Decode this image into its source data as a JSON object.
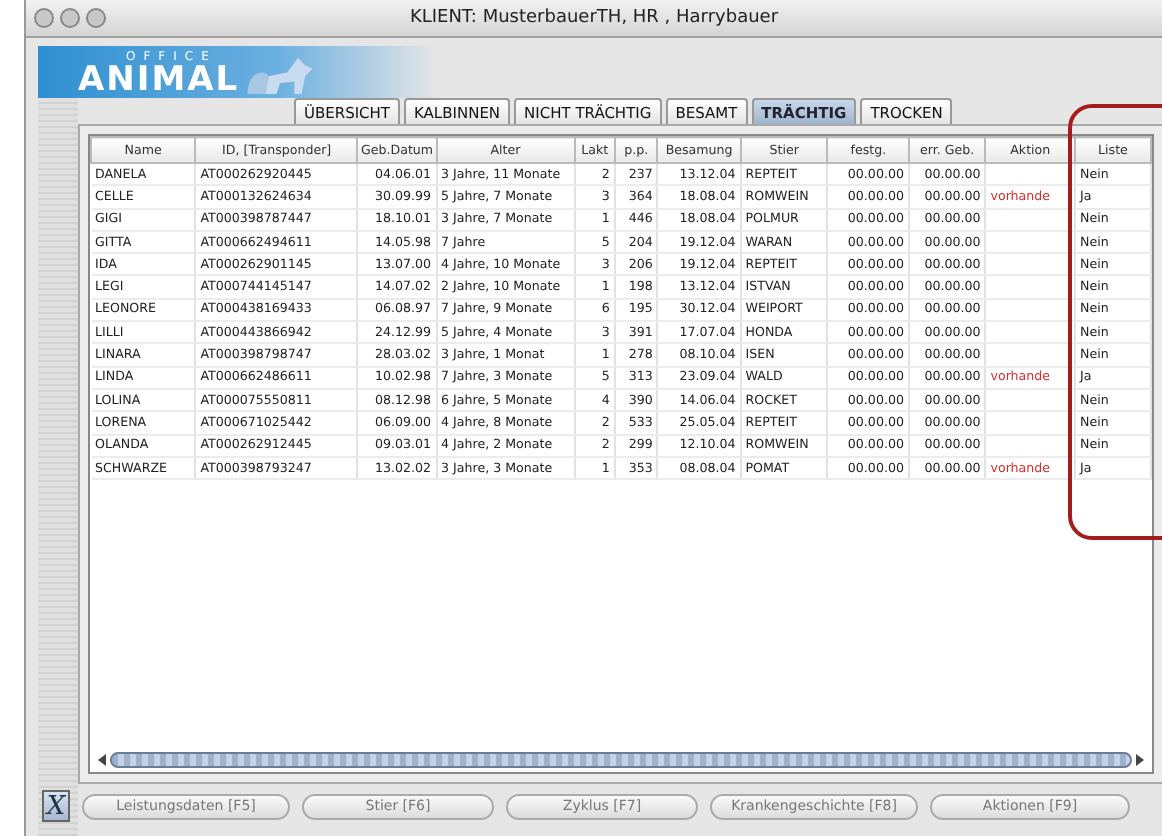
{
  "window": {
    "title": "KLIENT: MusterbauerTH, HR , Harrybauer"
  },
  "logo": {
    "overline": "OFFICE",
    "wordmark": "ANIMAL"
  },
  "tabs": [
    {
      "label": "ÜBERSICHT",
      "selected": false
    },
    {
      "label": "KALBINNEN",
      "selected": false
    },
    {
      "label": "NICHT TRÄCHTIG",
      "selected": false
    },
    {
      "label": "BESAMT",
      "selected": false
    },
    {
      "label": "TRÄCHTIG",
      "selected": true
    },
    {
      "label": "TROCKEN",
      "selected": false
    }
  ],
  "table": {
    "columns": [
      "Name",
      "ID, [Transponder]",
      "Geb.Datum",
      "Alter",
      "Lakt",
      "p.p.",
      "Besamung",
      "Stier",
      "festg.",
      "err. Geb.",
      "Aktion",
      "Liste"
    ],
    "rows": [
      [
        "DANELA",
        "AT000262920445",
        "04.06.01",
        "3 Jahre, 11 Monate",
        "2",
        "237",
        "13.12.04",
        "REPTEIT",
        "00.00.00",
        "00.00.00",
        "",
        "Nein"
      ],
      [
        "CELLE",
        "AT000132624634",
        "30.09.99",
        "5 Jahre, 7 Monate",
        "3",
        "364",
        "18.08.04",
        "ROMWEIN",
        "00.00.00",
        "00.00.00",
        "vorhande",
        "Ja"
      ],
      [
        "GIGI",
        "AT000398787447",
        "18.10.01",
        "3 Jahre, 7 Monate",
        "1",
        "446",
        "18.08.04",
        "POLMUR",
        "00.00.00",
        "00.00.00",
        "",
        "Nein"
      ],
      [
        "GITTA",
        "AT000662494611",
        "14.05.98",
        "7 Jahre",
        "5",
        "204",
        "19.12.04",
        "WARAN",
        "00.00.00",
        "00.00.00",
        "",
        "Nein"
      ],
      [
        "IDA",
        "AT000262901145",
        "13.07.00",
        "4 Jahre, 10 Monate",
        "3",
        "206",
        "19.12.04",
        "REPTEIT",
        "00.00.00",
        "00.00.00",
        "",
        "Nein"
      ],
      [
        "LEGI",
        "AT000744145147",
        "14.07.02",
        "2 Jahre, 10 Monate",
        "1",
        "198",
        "13.12.04",
        "ISTVAN",
        "00.00.00",
        "00.00.00",
        "",
        "Nein"
      ],
      [
        "LEONORE",
        "AT000438169433",
        "06.08.97",
        "7 Jahre, 9 Monate",
        "6",
        "195",
        "30.12.04",
        "WEIPORT",
        "00.00.00",
        "00.00.00",
        "",
        "Nein"
      ],
      [
        "LILLI",
        "AT000443866942",
        "24.12.99",
        "5 Jahre, 4 Monate",
        "3",
        "391",
        "17.07.04",
        "HONDA",
        "00.00.00",
        "00.00.00",
        "",
        "Nein"
      ],
      [
        "LINARA",
        "AT000398798747",
        "28.03.02",
        "3 Jahre, 1 Monat",
        "1",
        "278",
        "08.10.04",
        "ISEN",
        "00.00.00",
        "00.00.00",
        "",
        "Nein"
      ],
      [
        "LINDA",
        "AT000662486611",
        "10.02.98",
        "7 Jahre, 3 Monate",
        "5",
        "313",
        "23.09.04",
        "WALD",
        "00.00.00",
        "00.00.00",
        "vorhande",
        "Ja"
      ],
      [
        "LOLINA",
        "AT000075550811",
        "08.12.98",
        "6 Jahre, 5 Monate",
        "4",
        "390",
        "14.06.04",
        "ROCKET",
        "00.00.00",
        "00.00.00",
        "",
        "Nein"
      ],
      [
        "LORENA",
        "AT000671025442",
        "06.09.00",
        "4 Jahre, 8 Monate",
        "2",
        "533",
        "25.05.04",
        "REPTEIT",
        "00.00.00",
        "00.00.00",
        "",
        "Nein"
      ],
      [
        "OLANDA",
        "AT000262912445",
        "09.03.01",
        "4 Jahre, 2 Monate",
        "2",
        "299",
        "12.10.04",
        "ROMWEIN",
        "00.00.00",
        "00.00.00",
        "",
        "Nein"
      ],
      [
        "SCHWARZE",
        "AT000398793247",
        "13.02.02",
        "3 Jahre, 3 Monate",
        "1",
        "353",
        "08.08.04",
        "POMAT",
        "00.00.00",
        "00.00.00",
        "vorhande",
        "Ja"
      ]
    ]
  },
  "close_button": {
    "label": "X"
  },
  "buttons": [
    "Leistungsdaten [F5]",
    "Stier [F6]",
    "Zyklus [F7]",
    "Krankengeschichte [F8]",
    "Aktionen [F9]"
  ]
}
